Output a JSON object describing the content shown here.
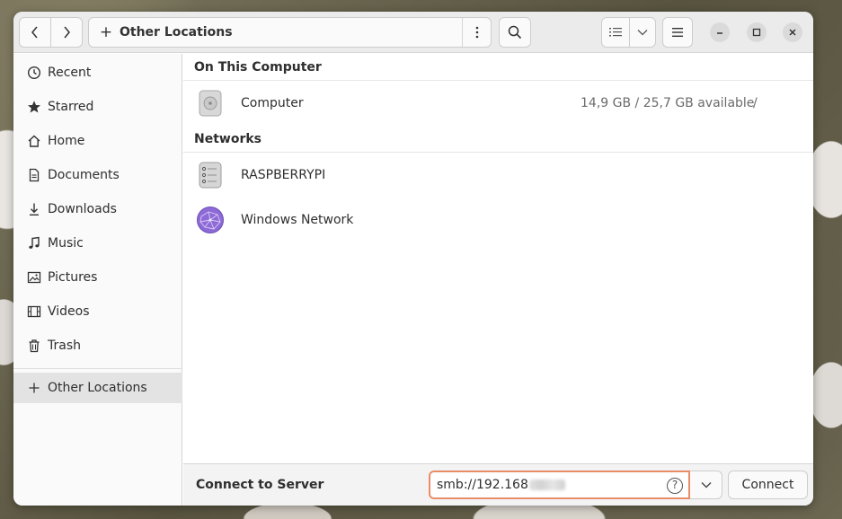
{
  "header": {
    "path_label": "Other Locations",
    "icons": {
      "back": "chevron-left-icon",
      "forward": "chevron-right-icon",
      "path_plus": "plus-icon",
      "path_menu": "vertical-dots-icon",
      "search": "search-icon",
      "view_list": "list-view-icon",
      "view_dropdown": "chevron-down-icon",
      "menu": "hamburger-menu-icon",
      "minimize": "minimize-icon",
      "maximize": "maximize-icon",
      "close": "close-icon"
    }
  },
  "sidebar": {
    "items": [
      {
        "label": "Recent",
        "icon": "clock-icon"
      },
      {
        "label": "Starred",
        "icon": "star-icon"
      },
      {
        "label": "Home",
        "icon": "home-icon"
      },
      {
        "label": "Documents",
        "icon": "document-icon"
      },
      {
        "label": "Downloads",
        "icon": "download-icon"
      },
      {
        "label": "Music",
        "icon": "music-icon"
      },
      {
        "label": "Pictures",
        "icon": "picture-icon"
      },
      {
        "label": "Videos",
        "icon": "video-icon"
      },
      {
        "label": "Trash",
        "icon": "trash-icon"
      }
    ],
    "other_locations": {
      "label": "Other Locations",
      "icon": "plus-icon",
      "active": true
    }
  },
  "main": {
    "on_this_computer": {
      "title": "On This Computer",
      "items": [
        {
          "name": "Computer",
          "info": "14,9 GB / 25,7 GB available",
          "mount": "/",
          "icon": "hard-disk-icon"
        }
      ]
    },
    "networks": {
      "title": "Networks",
      "items": [
        {
          "name": "RASPBERRYPI",
          "icon": "network-server-icon"
        },
        {
          "name": "Windows Network",
          "icon": "network-globe-icon"
        }
      ]
    }
  },
  "bottom": {
    "label": "Connect to Server",
    "server_value": "smb://192.168",
    "help_icon": "help-icon",
    "dropdown_icon": "chevron-down-icon",
    "connect_label": "Connect",
    "accent": "#e98d68"
  }
}
